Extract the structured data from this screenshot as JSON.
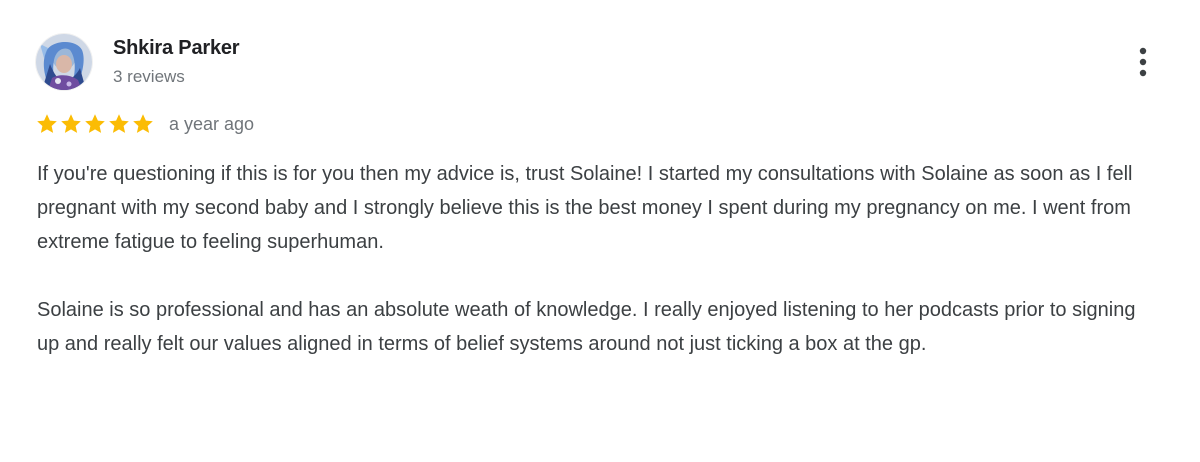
{
  "review": {
    "author": "Shkira Parker",
    "review_count": "3 reviews",
    "rating": 5,
    "rating_max": 5,
    "star_color": "#fbbc04",
    "time_ago": "a year ago",
    "paragraph_1": "If you're questioning if this is for you then my advice is, trust Solaine! I started my consultations with Solaine as soon as I fell pregnant with my second baby and I strongly believe this is the best money I spent during my pregnancy on me. I went from extreme fatigue to feeling superhuman.",
    "paragraph_2": "Solaine is so professional and has an absolute weath of knowledge. I really enjoyed listening to her podcasts prior to signing up and really felt our values aligned in terms of belief systems around not just ticking a box at the gp."
  },
  "icons": {
    "more": "more-vert-icon",
    "star": "star-icon"
  }
}
